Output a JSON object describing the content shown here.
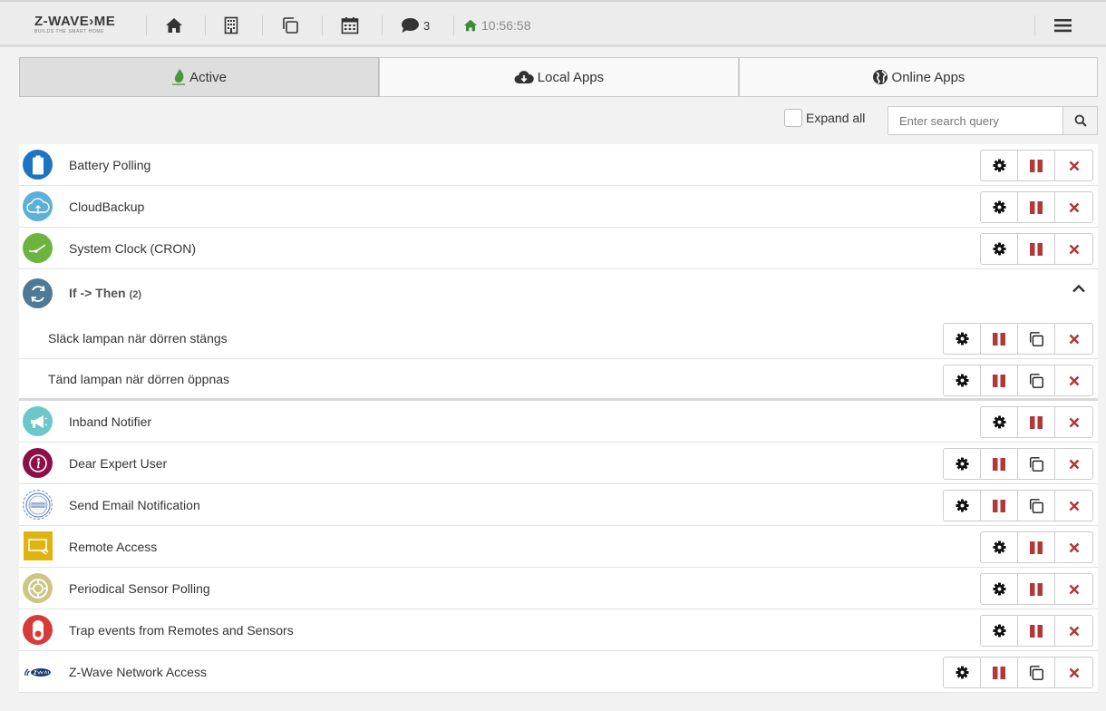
{
  "header": {
    "logo_main": "Z-WAVE›ME",
    "logo_sub": "BUILDS THE SMART HOME",
    "message_count": "3",
    "time": "10:56:58"
  },
  "tabs": [
    {
      "label": "Active",
      "icon": "leaf-icon",
      "active": true
    },
    {
      "label": "Local Apps",
      "icon": "cloud-download-icon",
      "active": false
    },
    {
      "label": "Online Apps",
      "icon": "globe-icon",
      "active": false
    }
  ],
  "toolbar": {
    "expand_label": "Expand all",
    "search_placeholder": "Enter search query"
  },
  "apps": [
    {
      "title": "Battery Polling",
      "icon": "battery-icon"
    },
    {
      "title": "CloudBackup",
      "icon": "cloud-icon"
    },
    {
      "title": "System Clock (CRON)",
      "icon": "clock-icon"
    }
  ],
  "group": {
    "title": "If -> Then",
    "count": "(2)",
    "items": [
      {
        "title": "Släck lampan när dörren stängs"
      },
      {
        "title": "Tänd lampan när dörren öppnas"
      }
    ]
  },
  "apps2": [
    {
      "title": "Inband Notifier",
      "icon": "megaphone-icon",
      "copy": false
    },
    {
      "title": "Dear Expert User",
      "icon": "info-icon",
      "copy": true
    },
    {
      "title": "Send Email Notification",
      "icon": "email-stamp-icon",
      "copy": true
    },
    {
      "title": "Remote Access",
      "icon": "remote-screen-icon",
      "copy": false
    },
    {
      "title": "Periodical Sensor Polling",
      "icon": "sensor-icon",
      "copy": false
    },
    {
      "title": "Trap events from Remotes and Sensors",
      "icon": "trap-switch-icon",
      "copy": false
    },
    {
      "title": "Z-Wave Network Access",
      "icon": "zwave-logo-icon",
      "copy": true
    }
  ],
  "colors": {
    "accent_red": "#b03a3a",
    "active_tab": "#dedede",
    "clock_green": "#3c8c3c"
  }
}
